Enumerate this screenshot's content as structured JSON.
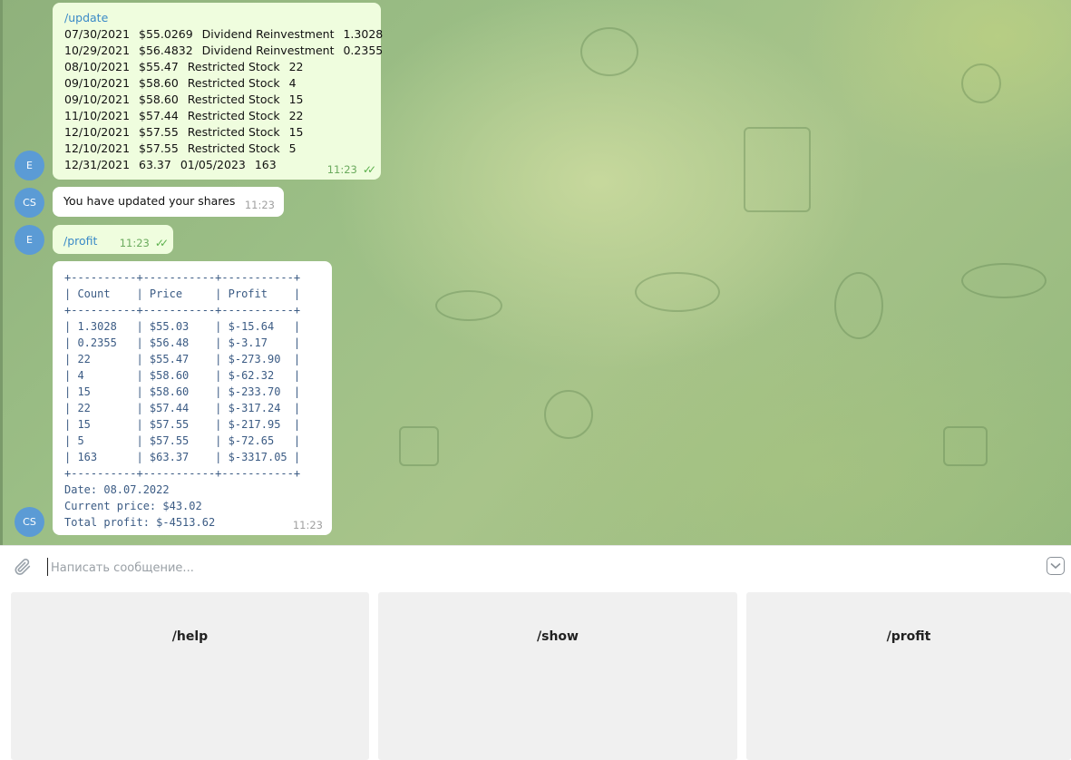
{
  "messages": {
    "update": {
      "command": "/update",
      "rows": [
        [
          "07/30/2021",
          "$55.0269",
          "Dividend Reinvestment",
          "1.3028"
        ],
        [
          "10/29/2021",
          "$56.4832",
          "Dividend Reinvestment",
          "0.2355"
        ],
        [
          "08/10/2021",
          "$55.47",
          "Restricted Stock",
          "22"
        ],
        [
          "09/10/2021",
          "$58.60",
          "Restricted Stock",
          "4"
        ],
        [
          "09/10/2021",
          "$58.60",
          "Restricted Stock",
          "15"
        ],
        [
          "11/10/2021",
          "$57.44",
          "Restricted Stock",
          "22"
        ],
        [
          "12/10/2021",
          "$57.55",
          "Restricted Stock",
          "15"
        ],
        [
          "12/10/2021",
          "$57.55",
          "Restricted Stock",
          "5"
        ],
        [
          "12/31/2021",
          "63.37",
          "01/05/2023",
          "163"
        ]
      ],
      "time": "11:23",
      "avatar": "E"
    },
    "updated_reply": {
      "text": "You have updated your shares",
      "time": "11:23",
      "avatar": "CS"
    },
    "profit_cmd": {
      "command": "/profit",
      "time": "11:23",
      "avatar": "E"
    },
    "profit_reply": {
      "table": "+----------+-----------+-----------+\n| Count    | Price     | Profit    |\n+----------+-----------+-----------+\n| 1.3028   | $55.03    | $-15.64   |\n| 0.2355   | $56.48    | $-3.17    |\n| 22       | $55.47    | $-273.90  |\n| 4        | $58.60    | $-62.32   |\n| 15       | $58.60    | $-233.70  |\n| 22       | $57.44    | $-317.24  |\n| 15       | $57.55    | $-217.95  |\n| 5        | $57.55    | $-72.65   |\n| 163      | $63.37    | $-3317.05 |\n+----------+-----------+-----------+",
      "date_line": "Date: 08.07.2022",
      "price_line": "Current price: $43.02",
      "total_line": "Total profit: $-4513.62",
      "time": "11:23",
      "avatar": "CS"
    }
  },
  "composer": {
    "placeholder": "Написать сообщение..."
  },
  "keyboard": {
    "help": "/help",
    "show": "/show",
    "profit": "/profit"
  },
  "icons": {
    "attach": "paperclip-icon",
    "keyboard": "keyboard-toggle-icon",
    "read": "double-check-icon"
  },
  "colors": {
    "outgoing_bubble": "#effdde",
    "avatar": "#5b9bd5",
    "link": "#3a8ac7",
    "mono_text": "#3b5b84"
  }
}
